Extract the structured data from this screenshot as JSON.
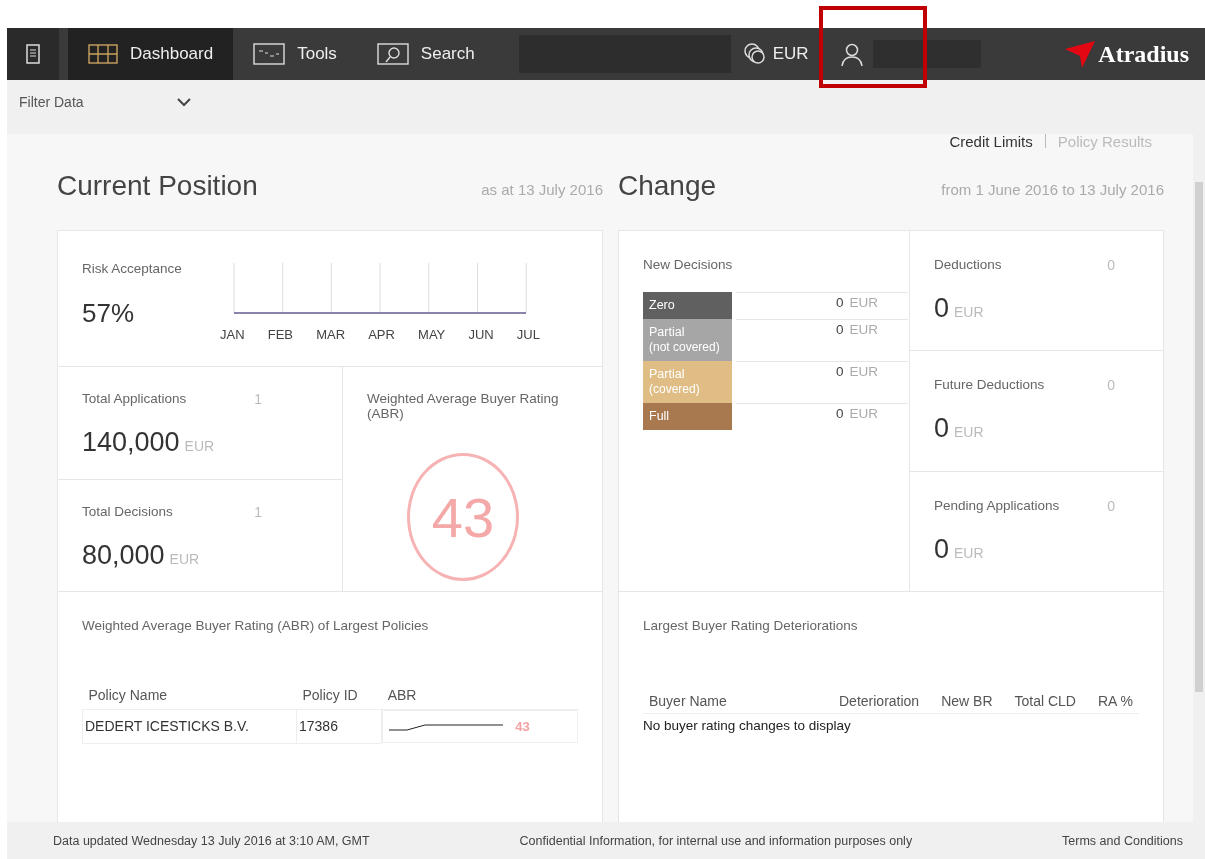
{
  "nav": {
    "items": [
      {
        "label": "Dashboard",
        "kind": "grid",
        "selected": true
      },
      {
        "label": "Tools",
        "kind": "tools",
        "selected": false
      },
      {
        "label": "Search",
        "kind": "search",
        "selected": false
      }
    ],
    "currency": "EUR",
    "brand": "Atradius"
  },
  "filter": {
    "label": "Filter Data"
  },
  "view_links": [
    {
      "label": "Credit Limits",
      "selected": true
    },
    {
      "label": "Policy Results",
      "selected": false
    }
  ],
  "current_position": {
    "title": "Current Position",
    "as_at": "as at 13 July 2016",
    "risk_acceptance": {
      "label": "Risk Acceptance",
      "value": "57%",
      "months": [
        "JAN",
        "FEB",
        "MAR",
        "APR",
        "MAY",
        "JUN",
        "JUL"
      ]
    },
    "totals": [
      {
        "label": "Total Applications",
        "count": "1",
        "amount": "140,000",
        "unit": "EUR"
      },
      {
        "label": "Total Decisions",
        "count": "1",
        "amount": "80,000",
        "unit": "EUR"
      }
    ],
    "abr": {
      "label": "Weighted Average Buyer Rating (ABR)",
      "value": "43"
    },
    "largest_policies": {
      "title": "Weighted Average Buyer Rating (ABR) of Largest Policies",
      "columns": [
        "Policy Name",
        "Policy ID",
        "ABR"
      ],
      "rows": [
        {
          "policy_name": "DEDERT ICESTICKS B.V.",
          "policy_id": "17386",
          "abr": "43"
        }
      ]
    }
  },
  "change": {
    "title": "Change",
    "period": "from 1 June 2016 to 13 July 2016",
    "new_decisions": {
      "label": "New Decisions",
      "rows": [
        {
          "label": "Zero",
          "sublabel": "",
          "amount": "0",
          "unit": "EUR",
          "color": "#606060"
        },
        {
          "label": "Partial",
          "sublabel": "(not covered)",
          "amount": "0",
          "unit": "EUR",
          "color": "#a6a6a6"
        },
        {
          "label": "Partial",
          "sublabel": "(covered)",
          "amount": "0",
          "unit": "EUR",
          "color": "#dfbd85"
        },
        {
          "label": "Full",
          "sublabel": "",
          "amount": "0",
          "unit": "EUR",
          "color": "#a8784e"
        }
      ]
    },
    "stats": [
      {
        "label": "Deductions",
        "count": "0",
        "amount": "0",
        "unit": "EUR"
      },
      {
        "label": "Future Deductions",
        "count": "0",
        "amount": "0",
        "unit": "EUR"
      },
      {
        "label": "Pending Applications",
        "count": "0",
        "amount": "0",
        "unit": "EUR"
      }
    ],
    "deteriorations": {
      "title": "Largest Buyer Rating Deteriorations",
      "columns": [
        "Buyer Name",
        "Deterioration",
        "New BR",
        "Total CLD",
        "RA %"
      ],
      "empty": "No buyer rating changes to display"
    }
  },
  "footer": {
    "updated": "Data updated Wednesday 13 July 2016 at 3:10 AM, GMT",
    "confidential": "Confidential Information, for internal use and information purposes only",
    "terms": "Terms and Conditions"
  }
}
